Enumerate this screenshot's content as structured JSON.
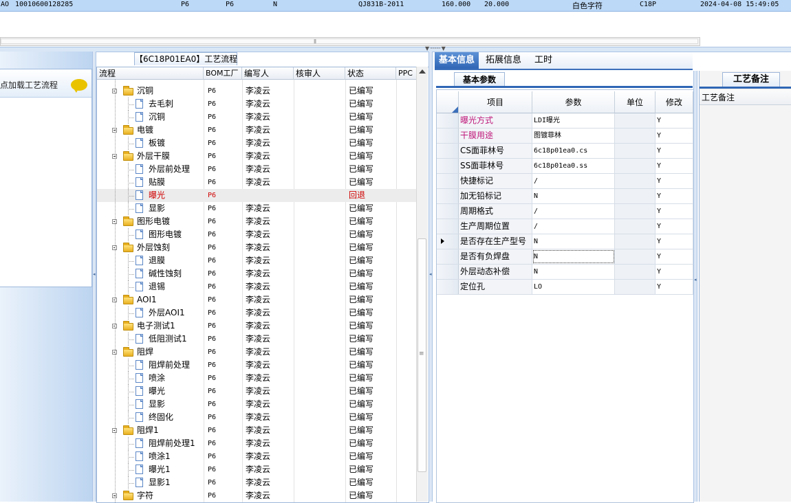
{
  "top_record": {
    "id_prefix": "AO",
    "id": "10010600128285",
    "factory": "P6",
    "factory2": "P6",
    "flag": "N",
    "standard": "QJ831B-2011",
    "val1": "160.000",
    "val2": "20.000",
    "char_color": "白色字符",
    "code": "C18P",
    "datetime": "2024-04-08 15:49:05"
  },
  "left_panel": {
    "hint": "点加载工艺流程"
  },
  "tree_panel": {
    "title": "【6C18P01EA0】工艺流程",
    "columns": [
      "流程",
      "BOM工厂",
      "编写人",
      "核审人",
      "状态",
      "PPC"
    ],
    "rows": [
      {
        "level": 1,
        "type": "folder",
        "name": "沉铜",
        "bom": "P6",
        "writer": "李凌云",
        "reviewer": "",
        "status": "已编写"
      },
      {
        "level": 2,
        "type": "doc",
        "name": "去毛刺",
        "bom": "P6",
        "writer": "李凌云",
        "reviewer": "",
        "status": "已编写"
      },
      {
        "level": 2,
        "type": "doc",
        "name": "沉铜",
        "bom": "P6",
        "writer": "李凌云",
        "reviewer": "",
        "status": "已编写"
      },
      {
        "level": 1,
        "type": "folder",
        "name": "电镀",
        "bom": "P6",
        "writer": "李凌云",
        "reviewer": "",
        "status": "已编写"
      },
      {
        "level": 2,
        "type": "doc",
        "name": "板镀",
        "bom": "P6",
        "writer": "李凌云",
        "reviewer": "",
        "status": "已编写"
      },
      {
        "level": 1,
        "type": "folder",
        "name": "外层干膜",
        "bom": "P6",
        "writer": "李凌云",
        "reviewer": "",
        "status": "已编写"
      },
      {
        "level": 2,
        "type": "doc",
        "name": "外层前处理",
        "bom": "P6",
        "writer": "李凌云",
        "reviewer": "",
        "status": "已编写"
      },
      {
        "level": 2,
        "type": "doc",
        "name": "贴膜",
        "bom": "P6",
        "writer": "李凌云",
        "reviewer": "",
        "status": "已编写"
      },
      {
        "level": 2,
        "type": "doc",
        "name": "曝光",
        "bom": "P6",
        "writer": "",
        "reviewer": "",
        "status": "回退",
        "returned": true
      },
      {
        "level": 2,
        "type": "doc",
        "name": "显影",
        "bom": "P6",
        "writer": "李凌云",
        "reviewer": "",
        "status": "已编写"
      },
      {
        "level": 1,
        "type": "folder",
        "name": "图形电镀",
        "bom": "P6",
        "writer": "李凌云",
        "reviewer": "",
        "status": "已编写"
      },
      {
        "level": 2,
        "type": "doc",
        "name": "图形电镀",
        "bom": "P6",
        "writer": "李凌云",
        "reviewer": "",
        "status": "已编写"
      },
      {
        "level": 1,
        "type": "folder",
        "name": "外层蚀刻",
        "bom": "P6",
        "writer": "李凌云",
        "reviewer": "",
        "status": "已编写"
      },
      {
        "level": 2,
        "type": "doc",
        "name": "退膜",
        "bom": "P6",
        "writer": "李凌云",
        "reviewer": "",
        "status": "已编写"
      },
      {
        "level": 2,
        "type": "doc",
        "name": "碱性蚀刻",
        "bom": "P6",
        "writer": "李凌云",
        "reviewer": "",
        "status": "已编写"
      },
      {
        "level": 2,
        "type": "doc",
        "name": "退锡",
        "bom": "P6",
        "writer": "李凌云",
        "reviewer": "",
        "status": "已编写"
      },
      {
        "level": 1,
        "type": "folder",
        "name": "AOI1",
        "bom": "P6",
        "writer": "李凌云",
        "reviewer": "",
        "status": "已编写"
      },
      {
        "level": 2,
        "type": "doc",
        "name": "外层AOI1",
        "bom": "P6",
        "writer": "李凌云",
        "reviewer": "",
        "status": "已编写"
      },
      {
        "level": 1,
        "type": "folder",
        "name": "电子测试1",
        "bom": "P6",
        "writer": "李凌云",
        "reviewer": "",
        "status": "已编写"
      },
      {
        "level": 2,
        "type": "doc",
        "name": "低阻测试1",
        "bom": "P6",
        "writer": "李凌云",
        "reviewer": "",
        "status": "已编写"
      },
      {
        "level": 1,
        "type": "folder",
        "name": "阻焊",
        "bom": "P6",
        "writer": "李凌云",
        "reviewer": "",
        "status": "已编写"
      },
      {
        "level": 2,
        "type": "doc",
        "name": "阻焊前处理",
        "bom": "P6",
        "writer": "李凌云",
        "reviewer": "",
        "status": "已编写"
      },
      {
        "level": 2,
        "type": "doc",
        "name": "喷涂",
        "bom": "P6",
        "writer": "李凌云",
        "reviewer": "",
        "status": "已编写"
      },
      {
        "level": 2,
        "type": "doc",
        "name": "曝光",
        "bom": "P6",
        "writer": "李凌云",
        "reviewer": "",
        "status": "已编写"
      },
      {
        "level": 2,
        "type": "doc",
        "name": "显影",
        "bom": "P6",
        "writer": "李凌云",
        "reviewer": "",
        "status": "已编写"
      },
      {
        "level": 2,
        "type": "doc",
        "name": "终固化",
        "bom": "P6",
        "writer": "李凌云",
        "reviewer": "",
        "status": "已编写"
      },
      {
        "level": 1,
        "type": "folder",
        "name": "阻焊1",
        "bom": "P6",
        "writer": "李凌云",
        "reviewer": "",
        "status": "已编写"
      },
      {
        "level": 2,
        "type": "doc",
        "name": "阻焊前处理1",
        "bom": "P6",
        "writer": "李凌云",
        "reviewer": "",
        "status": "已编写"
      },
      {
        "level": 2,
        "type": "doc",
        "name": "喷涂1",
        "bom": "P6",
        "writer": "李凌云",
        "reviewer": "",
        "status": "已编写"
      },
      {
        "level": 2,
        "type": "doc",
        "name": "曝光1",
        "bom": "P6",
        "writer": "李凌云",
        "reviewer": "",
        "status": "已编写"
      },
      {
        "level": 2,
        "type": "doc",
        "name": "显影1",
        "bom": "P6",
        "writer": "李凌云",
        "reviewer": "",
        "status": "已编写"
      },
      {
        "level": 1,
        "type": "folder",
        "name": "字符",
        "bom": "P6",
        "writer": "李凌云",
        "reviewer": "",
        "status": "已编写"
      }
    ]
  },
  "info_panel": {
    "tabs": [
      "基本信息",
      "拓展信息",
      "工时"
    ],
    "active_tab": "基本信息",
    "subtab": "基本参数",
    "columns": [
      "项目",
      "参数",
      "单位",
      "修改"
    ],
    "rows": [
      {
        "item": "曝光方式",
        "param": "LDI曝光",
        "unit": "",
        "modify": "Y",
        "highlight": true
      },
      {
        "item": "干膜用途",
        "param": "图镀菲林",
        "unit": "",
        "modify": "Y",
        "highlight": true
      },
      {
        "item": "CS面菲林号",
        "param": "6c18p01ea0.cs",
        "unit": "",
        "modify": "Y"
      },
      {
        "item": "SS面菲林号",
        "param": "6c18p01ea0.ss",
        "unit": "",
        "modify": "Y"
      },
      {
        "item": "快捷标记",
        "param": "/",
        "unit": "",
        "modify": "Y"
      },
      {
        "item": "加无铅标记",
        "param": "N",
        "unit": "",
        "modify": "Y"
      },
      {
        "item": "周期格式",
        "param": "/",
        "unit": "",
        "modify": "Y"
      },
      {
        "item": "生产周期位置",
        "param": "/",
        "unit": "",
        "modify": "Y"
      },
      {
        "item": "是否存在生产型号",
        "param": "N",
        "unit": "",
        "modify": "Y",
        "current": true
      },
      {
        "item": "是否有负焊盘",
        "param": "N",
        "unit": "",
        "modify": "Y",
        "focused": true
      },
      {
        "item": "外层动态补偿",
        "param": "N",
        "unit": "",
        "modify": "Y"
      },
      {
        "item": "定位孔",
        "param": "LO",
        "unit": "",
        "modify": "Y"
      }
    ]
  },
  "remarks_panel": {
    "tab": "工艺备注",
    "label": "工艺备注"
  },
  "colors": {
    "accent": "#2f66b5",
    "returned": "#d00000",
    "highlight_item": "#c0187a",
    "top_row": "#bcd9f7",
    "folder": "#e9b020"
  }
}
